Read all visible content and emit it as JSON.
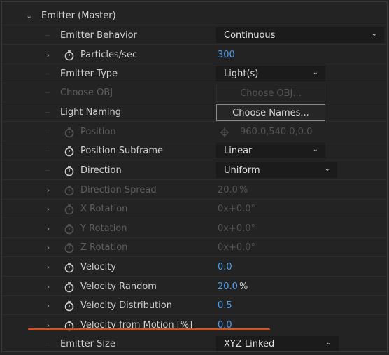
{
  "section": {
    "title": "Emitter (Master)",
    "expanded": true
  },
  "rows": {
    "emitter_behavior": {
      "label": "Emitter Behavior",
      "value": "Continuous"
    },
    "particles_sec": {
      "label": "Particles/sec",
      "value": "300"
    },
    "emitter_type": {
      "label": "Emitter Type",
      "value": "Light(s)"
    },
    "choose_obj": {
      "label": "Choose OBJ",
      "button": "Choose OBJ..."
    },
    "light_naming": {
      "label": "Light Naming",
      "button": "Choose Names..."
    },
    "position": {
      "label": "Position",
      "value": "960.0,540.0,0.0"
    },
    "position_subframe": {
      "label": "Position Subframe",
      "value": "Linear"
    },
    "direction": {
      "label": "Direction",
      "value": "Uniform"
    },
    "direction_spread": {
      "label": "Direction Spread",
      "value": "20.0",
      "unit": "%"
    },
    "x_rotation": {
      "label": "X Rotation",
      "value": "0x+0.0",
      "unit": "°"
    },
    "y_rotation": {
      "label": "Y Rotation",
      "value": "0x+0.0",
      "unit": "°"
    },
    "z_rotation": {
      "label": "Z Rotation",
      "value": "0x+0.0",
      "unit": "°"
    },
    "velocity": {
      "label": "Velocity",
      "value": "0.0"
    },
    "velocity_random": {
      "label": "Velocity Random",
      "value": "20.0",
      "unit": "%"
    },
    "velocity_distribution": {
      "label": "Velocity Distribution",
      "value": "0.5"
    },
    "velocity_from_motion": {
      "label": "Velocity from Motion [%]",
      "value": "0.0"
    },
    "emitter_size": {
      "label": "Emitter Size",
      "value": "XYZ Linked"
    }
  },
  "colors": {
    "accent_value": "#4a9ef0",
    "highlight_underline": "#d4531d"
  }
}
